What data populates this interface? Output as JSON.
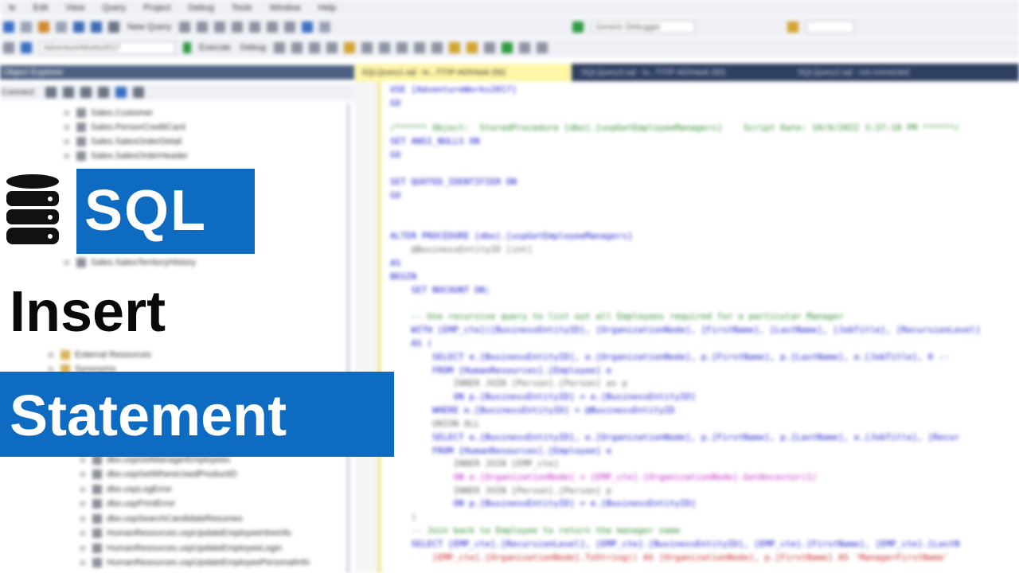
{
  "menubar": {
    "items": [
      "le",
      "Edit",
      "View",
      "Query",
      "Project",
      "Debug",
      "Tools",
      "Window",
      "Help"
    ]
  },
  "toolbar": {
    "new_query_label": "New Query",
    "database_value": "AdventureWorks2017",
    "execute_label": "Execute",
    "debug_label": "Debug",
    "debugger_value": "Generic Debugger"
  },
  "object_explorer": {
    "title": "Object Explorer",
    "connect_label": "Connect",
    "tables": [
      "Sales.Customer",
      "Sales.PersonCreditCard",
      "Sales.SalesOrderDetail",
      "Sales.SalesOrderHeader",
      "Sales.SalesTerritoryHistory"
    ],
    "folders": [
      "External Resources",
      "Synonyms"
    ],
    "procedures": [
      "dbo.uspGetManagerEmployees",
      "dbo.uspGetWhereUsedProductID",
      "dbo.uspLogError",
      "dbo.uspPrintError",
      "dbo.uspSearchCandidateResumes",
      "HumanResources.uspUpdateEmployeeHireInfo",
      "HumanResources.uspUpdateEmployeeLogin",
      "HumanResources.uspUpdateEmployeePersonalInfo"
    ]
  },
  "tabs": [
    "SQLQuery1.sql - lo...T\\TIP-AD\\Hask (56)",
    "SQLQuery3.sql - lo...T\\TIP-AD\\Hask (50)",
    "SQLQuery2.sql - not connected"
  ],
  "code_lines": [
    "USE [AdventureWorks2017]",
    "GO",
    "/****** Object:  StoredProcedure [dbo].[uspGetEmployeeManagers]    Script Date: 10/9/2022 3:37:18 PM ******/",
    "SET ANSI_NULLS ON",
    "GO",
    "SET QUOTED_IDENTIFIER ON",
    "GO",
    "ALTER PROCEDURE [dbo].[uspGetEmployeeManagers]",
    "    @BusinessEntityID [int]",
    "AS",
    "BEGIN",
    "    SET NOCOUNT ON;",
    "    -- Use recursive query to list out all Employees required for a particular Manager",
    "    WITH [EMP_cte]([BusinessEntityID], [OrganizationNode], [FirstName], [LastName], [JobTitle], [RecursionLevel]",
    "    AS (",
    "        SELECT e.[BusinessEntityID], e.[OrganizationNode], p.[FirstName], p.[LastName], e.[JobTitle], 0 --",
    "        FROM [HumanResources].[Employee] e",
    "            INNER JOIN [Person].[Person] as p",
    "            ON p.[BusinessEntityID] = e.[BusinessEntityID]",
    "        WHERE e.[BusinessEntityID] = @BusinessEntityID",
    "        UNION ALL",
    "        SELECT e.[BusinessEntityID], e.[OrganizationNode], p.[FirstName], p.[LastName], e.[JobTitle], [Recur",
    "        FROM [HumanResources].[Employee] e",
    "            INNER JOIN [EMP_cte]",
    "            ON e.[OrganizationNode] = [EMP_cte].[OrganizationNode].GetAncestor(1)",
    "            INNER JOIN [Person].[Person] p",
    "            ON p.[BusinessEntityID] = e.[BusinessEntityID]",
    "    )",
    "    -- Join back to Employee to return the manager name",
    "    SELECT [EMP_cte].[RecursionLevel], [EMP_cte].[BusinessEntityID], [EMP_cte].[FirstName], [EMP_cte].[LastN",
    "        [EMP_cte].[OrganizationNode].ToString() AS [OrganizationNode], p.[FirstName] AS 'ManagerFirstName'"
  ],
  "overlay": {
    "badge_sql": "SQL",
    "title_insert": "Insert",
    "badge_statement": "Statement"
  },
  "colors": {
    "badge_blue": "#0d6bc1",
    "title_black": "#0a0a0a",
    "keyword_blue": "#1515c8",
    "comment_green": "#2e8b2e"
  }
}
